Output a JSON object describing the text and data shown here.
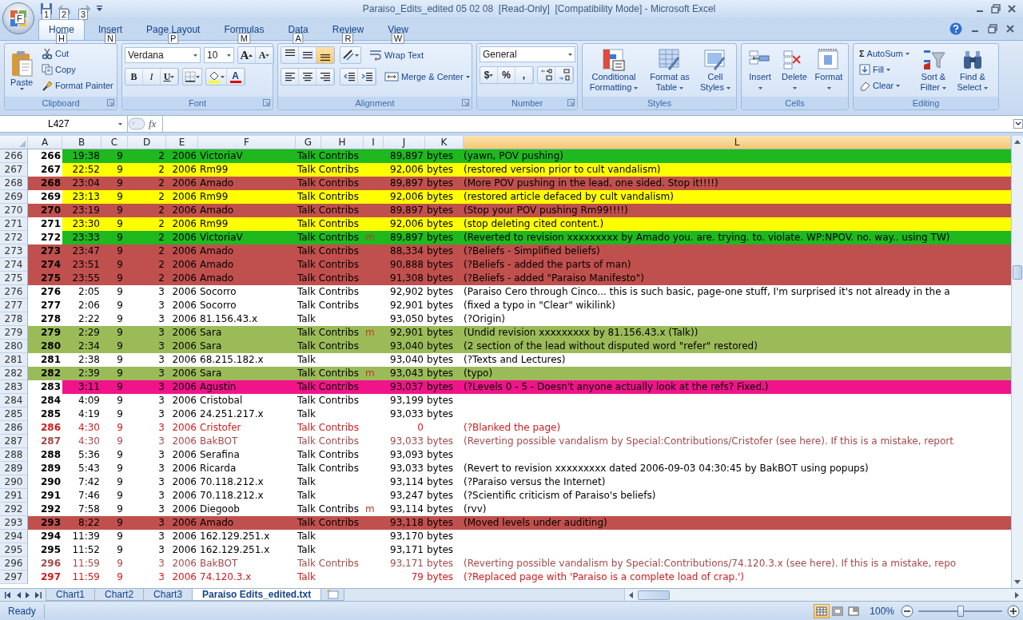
{
  "window": {
    "office_keytip": "F",
    "quick_access_keytips": [
      "1",
      "2",
      "3"
    ],
    "title": "Paraiso_Edits_edited 05 02 08  [Read-Only]  [Compatibility Mode] - Microsoft Excel"
  },
  "tabs": [
    {
      "label": "Home",
      "keytip": "H",
      "selected": true
    },
    {
      "label": "Insert",
      "keytip": "N",
      "selected": false
    },
    {
      "label": "Page Layout",
      "keytip": "P",
      "selected": false
    },
    {
      "label": "Formulas",
      "keytip": "M",
      "selected": false
    },
    {
      "label": "Data",
      "keytip": "A",
      "selected": false
    },
    {
      "label": "Review",
      "keytip": "R",
      "selected": false
    },
    {
      "label": "View",
      "keytip": "W",
      "selected": false
    }
  ],
  "ribbon": {
    "clipboard": {
      "label": "Clipboard",
      "paste": "Paste",
      "cut": "Cut",
      "copy": "Copy",
      "format_painter": "Format Painter"
    },
    "font": {
      "label": "Font",
      "font_name": "Verdana",
      "font_size": "10",
      "grow": "A",
      "shrink": "A",
      "bold": "B",
      "italic": "I",
      "underline": "U",
      "font_color": "A"
    },
    "alignment": {
      "label": "Alignment",
      "vertical_buttons": [
        {
          "kind": "top",
          "selected": false
        },
        {
          "kind": "middle",
          "selected": false
        },
        {
          "kind": "bottom",
          "selected": true
        }
      ],
      "wrap_text": "Wrap Text",
      "merge_center": "Merge & Center"
    },
    "number": {
      "label": "Number",
      "format": "General",
      "currency": "$",
      "percent": "%",
      "comma": ","
    },
    "styles": {
      "label": "Styles",
      "buttons": [
        {
          "kind": "conditional",
          "label": "Conditional Formatting"
        },
        {
          "kind": "table",
          "label": "Format as Table"
        },
        {
          "kind": "cellstyles",
          "label": "Cell Styles"
        }
      ]
    },
    "cells": {
      "label": "Cells",
      "buttons": [
        {
          "kind": "insert",
          "label": "Insert"
        },
        {
          "kind": "delete",
          "label": "Delete"
        },
        {
          "kind": "format",
          "label": "Format"
        }
      ]
    },
    "editing": {
      "label": "Editing",
      "sigma": "Σ",
      "autosum": "AutoSum",
      "fill": "Fill",
      "clear": "Clear",
      "sort_filter": "Sort & Filter",
      "find_select": "Find & Select"
    }
  },
  "formula_bar": {
    "name_box": "L427",
    "fx": "fx"
  },
  "columns": [
    {
      "label": "A",
      "selected": false
    },
    {
      "label": "B",
      "selected": false
    },
    {
      "label": "C",
      "selected": false
    },
    {
      "label": "D",
      "selected": false
    },
    {
      "label": "E",
      "selected": false
    },
    {
      "label": "F",
      "selected": false
    },
    {
      "label": "G",
      "selected": false
    },
    {
      "label": "H",
      "selected": false
    },
    {
      "label": "I",
      "selected": false
    },
    {
      "label": "J",
      "selected": false
    },
    {
      "label": "K",
      "selected": false
    },
    {
      "label": "L",
      "selected": true
    }
  ],
  "rows": [
    {
      "row": "266",
      "col_a": "266",
      "time": "19:38",
      "col_c": "9",
      "col_d": "2",
      "year": "2006",
      "user": "VictoriaV",
      "links": "Talk Contribs",
      "size": "89,897",
      "unit": "bytes",
      "comment": "(yawn, POV pushing)",
      "color": "#1fb81f",
      "fill_a": false,
      "kind": "plain"
    },
    {
      "row": "267",
      "col_a": "267",
      "time": "22:52",
      "col_c": "9",
      "col_d": "2",
      "year": "2006",
      "user": "Rm99",
      "links": "Talk Contribs",
      "size": "92,006",
      "unit": "bytes",
      "comment": "(restored version prior to cult vandalism)",
      "color": "#ffff00",
      "fill_a": false,
      "kind": "plain"
    },
    {
      "row": "268",
      "col_a": "268",
      "time": "23:04",
      "col_c": "9",
      "col_d": "2",
      "year": "2006",
      "user": "Amado",
      "links": "Talk Contribs",
      "size": "89,897",
      "unit": "bytes",
      "comment": "(More POV pushing in the lead, one sided. Stop it!!!!)",
      "color": "#c0504d",
      "fill_a": true,
      "kind": "plain"
    },
    {
      "row": "269",
      "col_a": "269",
      "time": "23:13",
      "col_c": "9",
      "col_d": "2",
      "year": "2006",
      "user": "Rm99",
      "links": "Talk Contribs",
      "size": "92,006",
      "unit": "bytes",
      "comment": "(restored article defaced by cult vandalism)",
      "color": "#ffff00",
      "fill_a": false,
      "kind": "plain"
    },
    {
      "row": "270",
      "col_a": "270",
      "time": "23:19",
      "col_c": "9",
      "col_d": "2",
      "year": "2006",
      "user": "Amado",
      "links": "Talk Contribs",
      "size": "89,897",
      "unit": "bytes",
      "comment": "(Stop your POV pushing Rm99!!!!)",
      "color": "#c0504d",
      "fill_a": true,
      "kind": "plain"
    },
    {
      "row": "271",
      "col_a": "271",
      "time": "23:30",
      "col_c": "9",
      "col_d": "2",
      "year": "2006",
      "user": "Rm99",
      "links": "Talk Contribs",
      "size": "92,006",
      "unit": "bytes",
      "comment": "(stop deleting cited content.)",
      "color": "#ffff00",
      "fill_a": false,
      "kind": "plain"
    },
    {
      "row": "272",
      "col_a": "272",
      "time": "23:33",
      "col_c": "9",
      "col_d": "2",
      "year": "2006",
      "user": "VictoriaV",
      "links": "Talk Contribs",
      "flag": "m",
      "size": "89,897",
      "unit": "bytes",
      "comment": "(Reverted to revision xxxxxxxxx by Amado you. are. trying. to. violate. WP:NPOV. no. way.. using TW)",
      "color": "#1fb81f",
      "fill_a": false,
      "kind": "plain"
    },
    {
      "row": "273",
      "col_a": "273",
      "time": "23:47",
      "col_c": "9",
      "col_d": "2",
      "year": "2006",
      "user": "Amado",
      "links": "Talk Contribs",
      "size": "88,334",
      "unit": "bytes",
      "comment": "(?Beliefs - Simplified beliefs)",
      "color": "#c0504d",
      "fill_a": true,
      "kind": "plain"
    },
    {
      "row": "274",
      "col_a": "274",
      "time": "23:51",
      "col_c": "9",
      "col_d": "2",
      "year": "2006",
      "user": "Amado",
      "links": "Talk Contribs",
      "size": "90,888",
      "unit": "bytes",
      "comment": "(?Beliefs - added the parts of man)",
      "color": "#c0504d",
      "fill_a": true,
      "kind": "plain"
    },
    {
      "row": "275",
      "col_a": "275",
      "time": "23:55",
      "col_c": "9",
      "col_d": "2",
      "year": "2006",
      "user": "Amado",
      "links": "Talk Contribs",
      "size": "91,308",
      "unit": "bytes",
      "comment": "(?Beliefs - added \"Paraiso Manifesto\")",
      "color": "#c0504d",
      "fill_a": true,
      "kind": "plain"
    },
    {
      "row": "276",
      "col_a": "276",
      "time": "2:05",
      "col_c": "9",
      "col_d": "3",
      "year": "2006",
      "user": "Socorro",
      "links": "Talk Contribs",
      "size": "92,902",
      "unit": "bytes",
      "comment": "(Paraiso Cero through Cinco... this is such basic, page-one stuff, I'm surprised it's not already in the a",
      "kind": "plain"
    },
    {
      "row": "277",
      "col_a": "277",
      "time": "2:06",
      "col_c": "9",
      "col_d": "3",
      "year": "2006",
      "user": "Socorro",
      "links": "Talk Contribs",
      "size": "92,901",
      "unit": "bytes",
      "comment": "(fixed a typo in \"Clear\" wikilink)",
      "kind": "plain"
    },
    {
      "row": "278",
      "col_a": "278",
      "time": "2:22",
      "col_c": "9",
      "col_d": "3",
      "year": "2006",
      "user": "81.156.43.x",
      "links": "Talk",
      "size": "93,050",
      "unit": "bytes",
      "comment": "(?Origin)",
      "kind": "plain"
    },
    {
      "row": "279",
      "col_a": "279",
      "time": "2:29",
      "col_c": "9",
      "col_d": "3",
      "year": "2006",
      "user": "Sara",
      "links": "Talk Contribs",
      "flag": "m",
      "size": "92,901",
      "unit": "bytes",
      "comment": "(Undid revision xxxxxxxxx by 81.156.43.x (Talk))",
      "color": "#9bbb59",
      "fill_a": true,
      "kind": "plain"
    },
    {
      "row": "280",
      "col_a": "280",
      "time": "2:34",
      "col_c": "9",
      "col_d": "3",
      "year": "2006",
      "user": "Sara",
      "links": "Talk Contribs",
      "size": "93,040",
      "unit": "bytes",
      "comment": "(2 section of the lead without disputed word \"refer\" restored)",
      "color": "#9bbb59",
      "fill_a": true,
      "kind": "plain"
    },
    {
      "row": "281",
      "col_a": "281",
      "time": "2:38",
      "col_c": "9",
      "col_d": "3",
      "year": "2006",
      "user": "68.215.182.x",
      "links": "Talk",
      "size": "93,040",
      "unit": "bytes",
      "comment": "(?Texts and Lectures)",
      "kind": "plain"
    },
    {
      "row": "282",
      "col_a": "282",
      "time": "2:39",
      "col_c": "9",
      "col_d": "3",
      "year": "2006",
      "user": "Sara",
      "links": "Talk Contribs",
      "flag": "m",
      "size": "93,043",
      "unit": "bytes",
      "comment": "(typo)",
      "color": "#9bbb59",
      "fill_a": true,
      "kind": "plain"
    },
    {
      "row": "283",
      "col_a": "283",
      "time": "3:11",
      "col_c": "9",
      "col_d": "3",
      "year": "2006",
      "user": "Agustin",
      "links": "Talk Contribs",
      "size": "93,037",
      "unit": "bytes",
      "comment": "(?Levels 0 - 5 - Doesn't anyone actually look at the refs? Fixed.)",
      "color": "#f0138a",
      "fill_a": false,
      "kind": "plain"
    },
    {
      "row": "284",
      "col_a": "284",
      "time": "4:09",
      "col_c": "9",
      "col_d": "3",
      "year": "2006",
      "user": "Cristobal",
      "links": "Talk Contribs",
      "size": "93,199",
      "unit": "bytes",
      "kind": "plain"
    },
    {
      "row": "285",
      "col_a": "285",
      "time": "4:19",
      "col_c": "9",
      "col_d": "3",
      "year": "2006",
      "user": "24.251.217.x",
      "links": "Talk",
      "size": "93,033",
      "unit": "bytes",
      "kind": "plain"
    },
    {
      "row": "286",
      "col_a": "286",
      "time": "4:30",
      "col_c": "9",
      "col_d": "3",
      "year": "2006",
      "user": "Cristofer",
      "links": "Talk Contribs",
      "size": "0",
      "comment": "(?Blanked the page)",
      "kind": "red"
    },
    {
      "row": "287",
      "col_a": "287",
      "time": "4:30",
      "col_c": "9",
      "col_d": "3",
      "year": "2006",
      "user": "BakBOT",
      "links": "Talk Contribs",
      "size": "93,033",
      "unit": "bytes",
      "comment": "(Reverting possible vandalism by Special:Contributions/Cristofer (see here). If this is a mistake, report",
      "kind": "brown"
    },
    {
      "row": "288",
      "col_a": "288",
      "time": "5:36",
      "col_c": "9",
      "col_d": "3",
      "year": "2006",
      "user": "Serafina",
      "links": "Talk Contribs",
      "size": "93,093",
      "unit": "bytes",
      "kind": "plain"
    },
    {
      "row": "289",
      "col_a": "289",
      "time": "5:43",
      "col_c": "9",
      "col_d": "3",
      "year": "2006",
      "user": "Ricarda",
      "links": "Talk Contribs",
      "size": "93,033",
      "unit": "bytes",
      "comment": "(Revert to revision xxxxxxxxx dated 2006-09-03 04:30:45 by BakBOT using popups)",
      "kind": "plain"
    },
    {
      "row": "290",
      "col_a": "290",
      "time": "7:42",
      "col_c": "9",
      "col_d": "3",
      "year": "2006",
      "user": "70.118.212.x",
      "links": "Talk",
      "size": "93,114",
      "unit": "bytes",
      "comment": "(?Paraiso versus the Internet)",
      "kind": "plain"
    },
    {
      "row": "291",
      "col_a": "291",
      "time": "7:46",
      "col_c": "9",
      "col_d": "3",
      "year": "2006",
      "user": "70.118.212.x",
      "links": "Talk",
      "size": "93,247",
      "unit": "bytes",
      "comment": "(?Scientific criticism of Paraiso's beliefs)",
      "kind": "plain"
    },
    {
      "row": "292",
      "col_a": "292",
      "time": "7:58",
      "col_c": "9",
      "col_d": "3",
      "year": "2006",
      "user": "Diegoob",
      "links": "Talk Contribs",
      "flag": "m",
      "size": "93,114",
      "unit": "bytes",
      "comment": "(rvv)",
      "kind": "plain"
    },
    {
      "row": "293",
      "col_a": "293",
      "time": "8:22",
      "col_c": "9",
      "col_d": "3",
      "year": "2006",
      "user": "Amado",
      "links": "Talk Contribs",
      "size": "93,118",
      "unit": "bytes",
      "comment": "(Moved levels under auditing)",
      "color": "#c0504d",
      "fill_a": true,
      "kind": "plain"
    },
    {
      "row": "294",
      "col_a": "294",
      "time": "11:39",
      "col_c": "9",
      "col_d": "3",
      "year": "2006",
      "user": "162.129.251.x",
      "links": "Talk",
      "size": "93,170",
      "unit": "bytes",
      "kind": "plain"
    },
    {
      "row": "295",
      "col_a": "295",
      "time": "11:52",
      "col_c": "9",
      "col_d": "3",
      "year": "2006",
      "user": "162.129.251.x",
      "links": "Talk",
      "size": "93,171",
      "unit": "bytes",
      "kind": "plain"
    },
    {
      "row": "296",
      "col_a": "296",
      "time": "11:59",
      "col_c": "9",
      "col_d": "3",
      "year": "2006",
      "user": "BakBOT",
      "links": "Talk Contribs",
      "size": "93,171",
      "unit": "bytes",
      "comment": "(Reverting possible vandalism by Special:Contributions/74.120.3.x (see here). If this is a mistake, repo",
      "kind": "brown"
    },
    {
      "row": "297",
      "col_a": "297",
      "time": "11:59",
      "col_c": "9",
      "col_d": "3",
      "year": "2006",
      "user": "74.120.3.x",
      "links": "Talk",
      "size": "79",
      "unit": "bytes",
      "comment": "(?Replaced page with 'Paraiso is a complete load of crap.')",
      "kind": "red"
    }
  ],
  "sheet_tabs": [
    {
      "label": "Chart1",
      "selected": false
    },
    {
      "label": "Chart2",
      "selected": false
    },
    {
      "label": "Chart3",
      "selected": false
    },
    {
      "label": "Paraiso Edits_edited.txt",
      "selected": true
    }
  ],
  "status_bar": {
    "status": "Ready",
    "views": [
      {
        "kind": "normal",
        "selected": true
      },
      {
        "kind": "page_layout",
        "selected": false
      },
      {
        "kind": "page_break",
        "selected": false
      }
    ],
    "zoom": "100%",
    "zoom_slider": {
      "level": 0.5
    }
  }
}
